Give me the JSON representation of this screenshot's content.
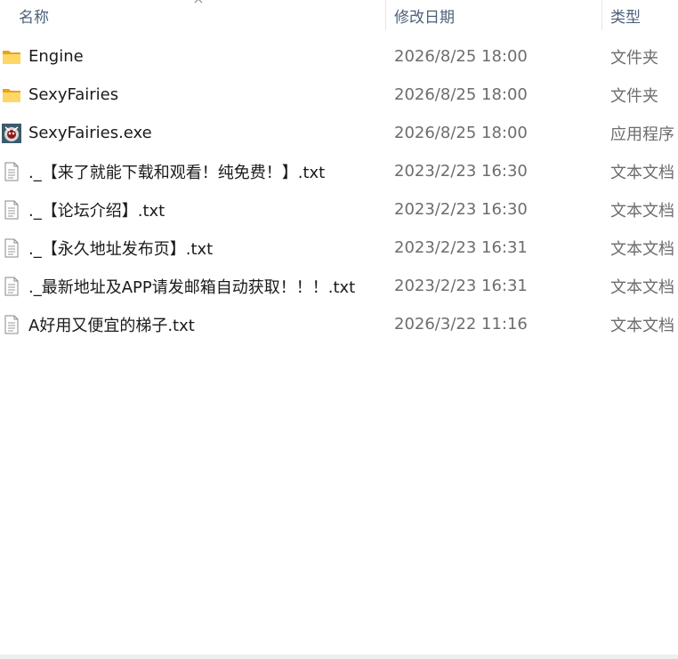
{
  "columns": {
    "name": "名称",
    "date": "修改日期",
    "type": "类型"
  },
  "files": [
    {
      "icon": "folder-icon",
      "name": "Engine",
      "date": "2026/8/25 18:00",
      "type": "文件夹"
    },
    {
      "icon": "folder-icon",
      "name": "SexyFairies",
      "date": "2026/8/25 18:00",
      "type": "文件夹"
    },
    {
      "icon": "exe-app-icon",
      "name": "SexyFairies.exe",
      "date": "2026/8/25 18:00",
      "type": "应用程序"
    },
    {
      "icon": "text-file-icon",
      "name": "._【来了就能下载和观看！纯免费！】.txt",
      "date": "2023/2/23 16:30",
      "type": "文本文档"
    },
    {
      "icon": "text-file-icon",
      "name": "._【论坛介绍】.txt",
      "date": "2023/2/23 16:30",
      "type": "文本文档"
    },
    {
      "icon": "text-file-icon",
      "name": "._【永久地址发布页】.txt",
      "date": "2023/2/23 16:31",
      "type": "文本文档"
    },
    {
      "icon": "text-file-icon",
      "name": "._最新地址及APP请发邮箱自动获取！！！.txt",
      "date": "2023/2/23 16:31",
      "type": "文本文档"
    },
    {
      "icon": "text-file-icon",
      "name": "A好用又便宜的梯子.txt",
      "date": "2026/3/22 11:16",
      "type": "文本文档"
    }
  ]
}
